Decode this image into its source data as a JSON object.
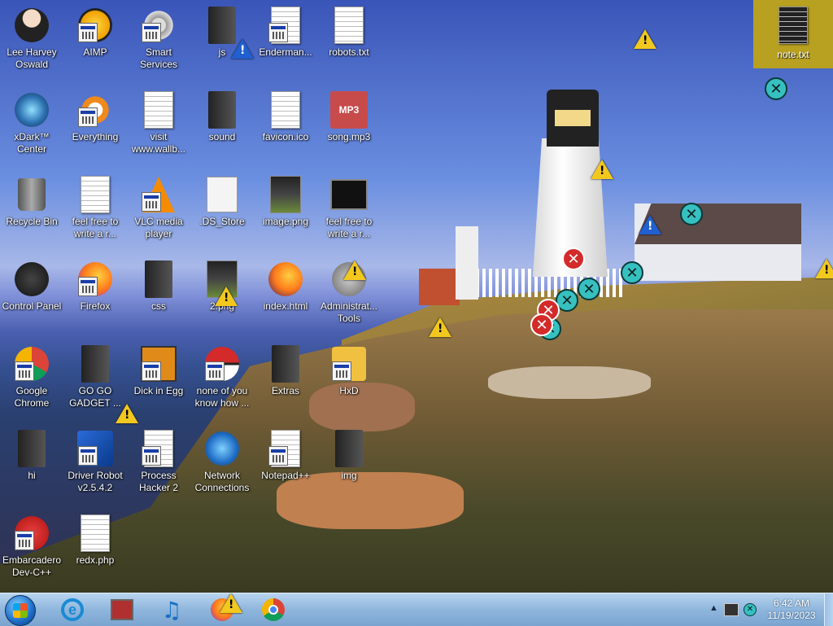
{
  "desktop": {
    "icons": [
      {
        "label": "Lee Harvey Oswald",
        "icon": "anime-avatar-icon"
      },
      {
        "label": "AIMP",
        "icon": "aimp-icon"
      },
      {
        "label": "Smart Services",
        "icon": "gears-icon"
      },
      {
        "label": "js",
        "icon": "folder-dark-icon"
      },
      {
        "label": "Enderman...",
        "icon": "application-icon"
      },
      {
        "label": "robots.txt",
        "icon": "text-file-icon"
      },
      {
        "label": "xDark™ Center",
        "icon": "xdark-center-icon"
      },
      {
        "label": "Everything",
        "icon": "everything-search-icon"
      },
      {
        "label": "visit www.wallb...",
        "icon": "text-file-icon"
      },
      {
        "label": "sound",
        "icon": "folder-dark-icon"
      },
      {
        "label": "favicon.ico",
        "icon": "ico-file-icon"
      },
      {
        "label": "song.mp3",
        "icon": "mp3-file-icon",
        "badge": "MP3"
      },
      {
        "label": "Recycle Bin",
        "icon": "recycle-bin-icon"
      },
      {
        "label": "feel free to write a r...",
        "icon": "text-file-icon"
      },
      {
        "label": "VLC media player",
        "icon": "vlc-icon"
      },
      {
        "label": ".DS_Store",
        "icon": "ds-store-file-icon"
      },
      {
        "label": "image.png",
        "icon": "png-image-icon"
      },
      {
        "label": "feel free to write a r...",
        "icon": "terminal-file-icon"
      },
      {
        "label": "Control Panel",
        "icon": "control-panel-icon"
      },
      {
        "label": "Firefox",
        "icon": "firefox-icon"
      },
      {
        "label": "css",
        "icon": "folder-dark-icon"
      },
      {
        "label": "2.png",
        "icon": "png-image-icon"
      },
      {
        "label": "index.html",
        "icon": "firefox-html-icon"
      },
      {
        "label": "Administrat... Tools",
        "icon": "admin-tools-icon"
      },
      {
        "label": "Google Chrome",
        "icon": "chrome-icon"
      },
      {
        "label": "GO GO GADGET ...",
        "icon": "folder-dark-icon"
      },
      {
        "label": "Dick in Egg",
        "icon": "dick-in-egg-icon"
      },
      {
        "label": "none of you know how ...",
        "icon": "pokeball-icon"
      },
      {
        "label": "Extras",
        "icon": "folder-dark-icon"
      },
      {
        "label": "HxD",
        "icon": "hxd-icon"
      },
      {
        "label": "hi",
        "icon": "folder-dark-icon"
      },
      {
        "label": "Driver Robot v2.5.4.2",
        "icon": "driver-robot-icon"
      },
      {
        "label": "Process Hacker 2",
        "icon": "process-hacker-icon"
      },
      {
        "label": "Network Connections",
        "icon": "network-connections-icon"
      },
      {
        "label": "Notepad++",
        "icon": "notepadpp-icon"
      },
      {
        "label": "img",
        "icon": "folder-dark-icon"
      },
      {
        "label": "Embarcadero Dev-C++",
        "icon": "devcpp-icon"
      },
      {
        "label": "redx.php",
        "icon": "php-file-icon"
      }
    ],
    "note_panel": {
      "label": "note.txt",
      "icon": "notepad-dark-icon"
    }
  },
  "taskbar": {
    "start": "start-orb",
    "pinned": [
      {
        "name": "internet-explorer-icon",
        "glyph": "e"
      },
      {
        "name": "store-bag-icon",
        "glyph": ""
      },
      {
        "name": "music-note-icon",
        "glyph": "♫"
      },
      {
        "name": "firefox-icon",
        "glyph": ""
      },
      {
        "name": "chrome-icon",
        "glyph": ""
      }
    ],
    "tray": {
      "time": "6:42 AM",
      "date": "11/19/2023",
      "arrow": "▲"
    }
  },
  "overlays": {
    "warning_glyph": "!",
    "close_glyph": "✕"
  }
}
